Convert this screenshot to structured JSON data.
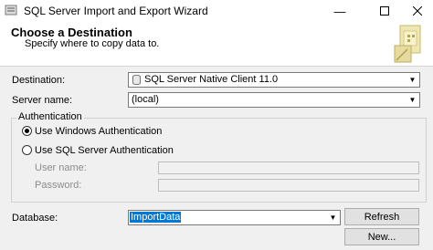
{
  "window": {
    "title": "SQL Server Import and Export Wizard",
    "icon": "wizard-app-icon",
    "controls": [
      "minimize-icon",
      "maximize-icon",
      "close-icon"
    ]
  },
  "header": {
    "title": "Choose a Destination",
    "subtitle": "Specify where to copy data to."
  },
  "destination": {
    "label": "Destination:",
    "value": "SQL Server Native Client 11.0",
    "icon": "database-icon"
  },
  "server": {
    "label": "Server name:",
    "value": "(local)"
  },
  "authentication": {
    "group_label": "Authentication",
    "options": [
      {
        "label": "Use Windows Authentication",
        "checked": true
      },
      {
        "label": "Use SQL Server Authentication",
        "checked": false
      }
    ],
    "username_label": "User name:",
    "password_label": "Password:",
    "username_value": "",
    "password_value": ""
  },
  "database": {
    "label": "Database:",
    "value": "ImportData",
    "refresh_label": "Refresh",
    "new_label": "New..."
  },
  "colors": {
    "selection": "#0078d7",
    "window_bg": "#f0f0f0"
  }
}
